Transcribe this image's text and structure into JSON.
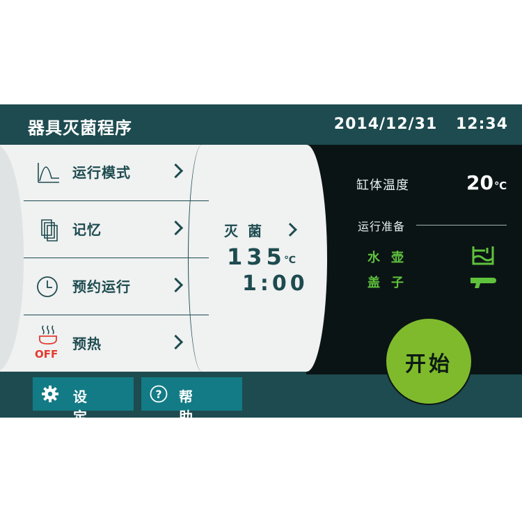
{
  "header": {
    "title": "器具灭菌程序",
    "date": "2014/12/31",
    "time": "12:34"
  },
  "menu": {
    "items": [
      {
        "label": "运行模式",
        "icon": "waveform-icon"
      },
      {
        "label": "记忆",
        "icon": "documents-icon"
      },
      {
        "label": "预约运行",
        "icon": "clock-icon"
      },
      {
        "label": "预热",
        "icon": "steam-pot-icon",
        "badge": "OFF"
      }
    ]
  },
  "program": {
    "name": "灭菌",
    "temperature": "135",
    "temperature_unit": "℃",
    "duration": "1:00"
  },
  "status": {
    "tank_label": "缸体温度",
    "tank_value": "20",
    "tank_unit": "℃",
    "ready_label": "运行准备",
    "ready_items": [
      {
        "label": "水壶",
        "icon": "kettle-icon"
      },
      {
        "label": "盖子",
        "icon": "lid-icon"
      }
    ]
  },
  "start_button": {
    "label": "开始"
  },
  "bottom_bar": {
    "settings_label": "设定",
    "help_label": "帮助"
  },
  "colors": {
    "frame": "#1d4b4f",
    "dark_panel": "#0b1415",
    "light_panel": "#f0f1f1",
    "accent_green": "#7fba2d",
    "ready_green": "#5fc23c",
    "button_teal": "#137b85",
    "off_red": "#e23b2e"
  }
}
